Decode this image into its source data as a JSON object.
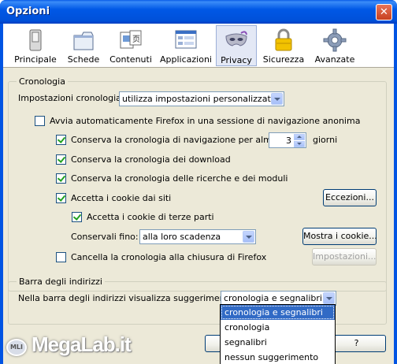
{
  "window": {
    "title": "Opzioni",
    "close_glyph": "✕"
  },
  "toolbar": {
    "items": [
      {
        "label": "Principale",
        "icon": "switch-icon"
      },
      {
        "label": "Schede",
        "icon": "tabs-icon"
      },
      {
        "label": "Contenuti",
        "icon": "content-icon"
      },
      {
        "label": "Applicazioni",
        "icon": "applications-icon"
      },
      {
        "label": "Privacy",
        "icon": "privacy-mask-icon",
        "selected": true
      },
      {
        "label": "Sicurezza",
        "icon": "padlock-icon"
      },
      {
        "label": "Avanzate",
        "icon": "gear-icon"
      }
    ]
  },
  "history": {
    "group_title": "Cronologia",
    "settings_label": "Impostazioni cronologia:",
    "settings_value": "utilizza impostazioni personalizzate",
    "private_mode_label": "Avvia automaticamente Firefox in una sessione di navigazione anonima",
    "private_mode_checked": false,
    "keep_history_label": "Conserva la cronologia di navigazione per almeno",
    "keep_history_checked": true,
    "days_value": "3",
    "days_unit": "giorni",
    "download_label": "Conserva la cronologia dei download",
    "download_checked": true,
    "forms_label": "Conserva la cronologia delle ricerche e dei moduli",
    "forms_checked": true,
    "cookies_label": "Accetta i cookie dai siti",
    "cookies_checked": true,
    "exceptions_button": "Eccezioni...",
    "third_party_label": "Accetta i cookie di terze parti",
    "third_party_checked": true,
    "keep_until_label": "Conservali fino:",
    "keep_until_value": "alla loro scadenza",
    "show_cookies_button": "Mostra i cookie...",
    "clear_on_close_label": "Cancella la cronologia alla chiusura di Firefox",
    "clear_on_close_checked": false,
    "settings_button": "Impostazioni..."
  },
  "location_bar": {
    "group_title": "Barra degli indirizzi",
    "suggest_label": "Nella barra degli indirizzi visualizza suggerimenti da:",
    "suggest_value": "cronologia e segnalibri",
    "options": [
      "cronologia e segnalibri",
      "cronologia",
      "segnalibri",
      "nessun suggerimento"
    ],
    "selected_index": 0
  },
  "footer": {
    "help_button": "?"
  },
  "watermark": {
    "text": "MegaLab.it",
    "badge": "MLI"
  }
}
